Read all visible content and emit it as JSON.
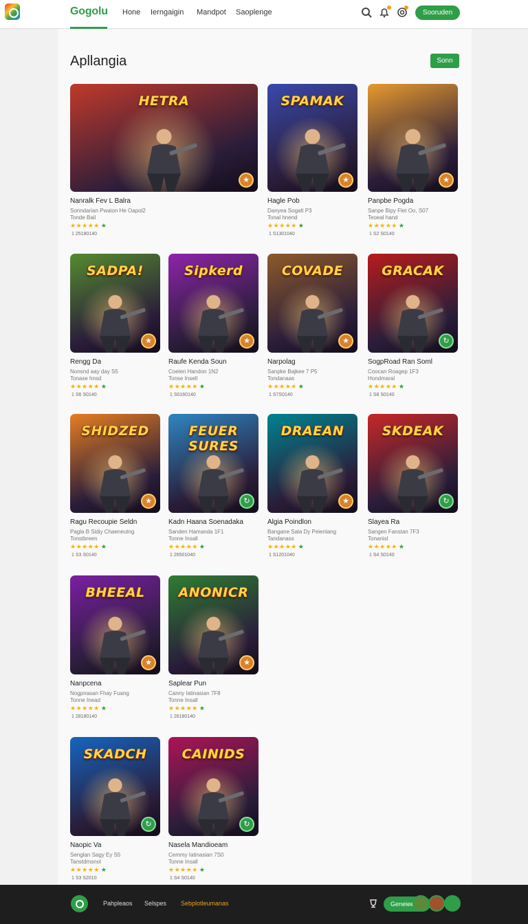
{
  "header": {
    "brand": "Gogolu",
    "nav": [
      "Hone",
      "Ierngaigin",
      "Mandpot",
      "Saoplenge"
    ],
    "signin": "Sooruden"
  },
  "page": {
    "title": "Apllangia",
    "sort_label": "Sonn"
  },
  "games": [
    {
      "thumb": "HETRA",
      "name": "Nanralk Fev L Balra",
      "sub1": "Sonndarian Pwaion He Oapol2",
      "sub2": "Tonde Bail",
      "count": "1 25180140",
      "accent": "#c0392b",
      "badge": "orange"
    },
    {
      "thumb": "SPAMAK",
      "name": "Hagle Pob",
      "sub1": "Danyea Sogalt P3",
      "sub2": "Tonal hnend",
      "count": "1 S1301040",
      "accent": "#3949ab",
      "badge": "orange"
    },
    {
      "thumb": "",
      "name": "Panpbe Pogda",
      "sub1": "Sanpe Bipy Flet Oo, S07",
      "sub2": "Teoeal hand",
      "count": "1 S2 S0140",
      "accent": "#e69a2e",
      "badge": "orange"
    },
    {
      "thumb": "SADPA!",
      "name": "Rengg Da",
      "sub1": "Nonsnd aay day S5",
      "sub2": "Tonase hnsd",
      "count": "1 S6 S0140",
      "accent": "#558b2f",
      "badge": "orange"
    },
    {
      "thumb": "Sipkerd",
      "name": "Raufe Kenda Soun",
      "sub1": "Coelen Handon 1N2",
      "sub2": "Tonse Insell",
      "count": "1 S0160140",
      "accent": "#8e24aa",
      "badge": "orange"
    },
    {
      "thumb": "COVADE",
      "name": "Narpolag",
      "sub1": "Sanpke Bajkee 7 P5",
      "sub2": "Tondanaas",
      "count": "1 S7S0140",
      "accent": "#8d5a2b",
      "badge": "orange"
    },
    {
      "thumb": "GRACAK",
      "name": "SogpRoad Ran Soml",
      "sub1": "Coocan Roagep 1F3",
      "sub2": "Hondmaral",
      "count": "1 S8 S0140",
      "accent": "#b71c1c",
      "badge": "green"
    },
    {
      "thumb": "SHIDZED",
      "name": "Ragu Recoupie Seldn",
      "sub1": "Pagla B Sidiy Chaeneutng",
      "sub2": "Tonstbreen",
      "count": "1 S3 S0140",
      "accent": "#e67e22",
      "badge": "orange"
    },
    {
      "thumb": "FEUER SURES",
      "name": "Kadn Haana Soenadaka",
      "sub1": "Sanden Hamanda 1F1",
      "sub2": "Tonne Insall",
      "count": "1 26501040",
      "accent": "#2e86c1",
      "badge": "green"
    },
    {
      "thumb": "DRAEAN",
      "name": "Algia Poindlon",
      "sub1": "Bangane Sala Dy Peienlang",
      "sub2": "Tandanass",
      "count": "1 S1201040",
      "accent": "#00838f",
      "badge": "orange"
    },
    {
      "thumb": "SKDEAK",
      "name": "Slayea Ra",
      "sub1": "Sangen Fanstan 7F3",
      "sub2": "Tonanisl",
      "count": "1 S4 S0140",
      "accent": "#c62828",
      "badge": "green"
    },
    {
      "thumb": "BHEEAL",
      "name": "Nanpcena",
      "sub1": "Nogpnasan Fhay Fuang",
      "sub2": "Tonne Inead",
      "count": "1 28180140",
      "accent": "#7b1fa2",
      "badge": "orange"
    },
    {
      "thumb": "ANONICR",
      "name": "Saplear Pun",
      "sub1": "Canny Iatinasian 7F8",
      "sub2": "Tonne Insall",
      "count": "1 26180140",
      "accent": "#2e7d32",
      "badge": "orange"
    },
    {
      "thumb": "SKADCH",
      "name": "Naopic Va",
      "sub1": "Senglan Sagy Ey S5",
      "sub2": "Tanstdmsnol",
      "count": "1 S3 S2010",
      "accent": "#1565c0",
      "badge": "green"
    },
    {
      "thumb": "CAINIDS",
      "name": "Nasela Mandioeam",
      "sub1": "Cemmy Iatinasian 7S0",
      "sub2": "Tonne Insall",
      "count": "1 S4 S0140",
      "accent": "#ad1457",
      "badge": "green"
    }
  ],
  "footer": {
    "links": [
      "Pahpleaos",
      "Selspes",
      "Sebplotleumanas"
    ],
    "cta": "Geneiee"
  }
}
